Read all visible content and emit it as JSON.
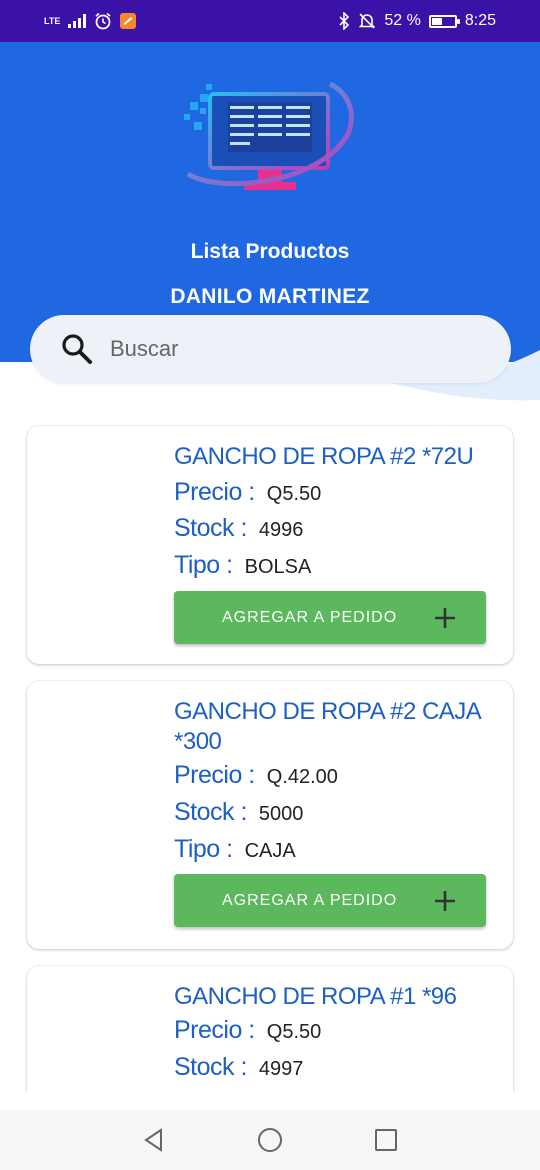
{
  "status_bar": {
    "network": "LTE",
    "battery_percent": "52 %",
    "battery_level": 0.52,
    "time": "8:25",
    "icons": [
      "signal-icon",
      "alarm-icon",
      "app-notification-icon",
      "bluetooth-icon",
      "mute-icon",
      "battery-icon"
    ]
  },
  "header": {
    "logo": "computer-binary-logo",
    "title": "Lista Productos",
    "user_name": "DANILO MARTINEZ",
    "background_color": "#1f68e2"
  },
  "search": {
    "placeholder": "Buscar",
    "value": ""
  },
  "products": [
    {
      "name": "GANCHO DE ROPA #2 *72U",
      "price_label": "Precio :",
      "price": "Q5.50",
      "stock_label": "Stock :",
      "stock": "4996",
      "type_label": "Tipo :",
      "type": "BOLSA",
      "button_label": "AGREGAR A PEDIDO"
    },
    {
      "name": "GANCHO DE ROPA #2 CAJA *300",
      "price_label": "Precio :",
      "price": "Q.42.00",
      "stock_label": "Stock :",
      "stock": "5000",
      "type_label": "Tipo :",
      "type": "CAJA",
      "button_label": "AGREGAR A PEDIDO"
    },
    {
      "name": "GANCHO DE ROPA #1 *96",
      "price_label": "Precio :",
      "price": "Q5.50",
      "stock_label": "Stock :",
      "stock": "4997"
    }
  ],
  "colors": {
    "accent_blue": "#1e5fc4",
    "button_green": "#5cb85c",
    "status_bar": "#3a12a8"
  },
  "nav_bar": {
    "buttons": [
      "back-icon",
      "home-icon",
      "recents-icon"
    ]
  }
}
